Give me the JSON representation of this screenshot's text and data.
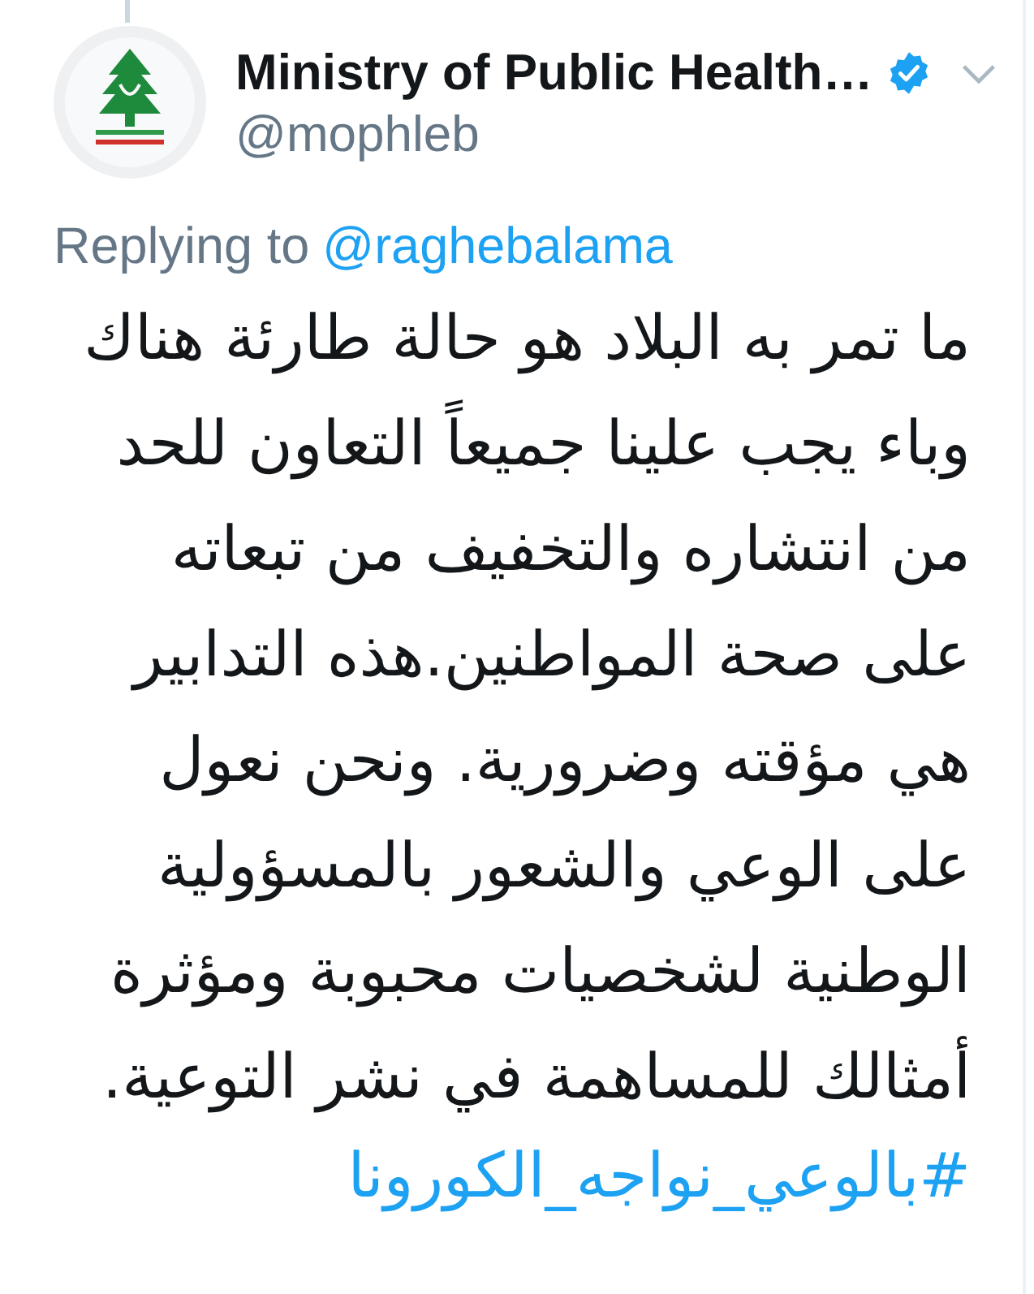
{
  "tweet": {
    "author": {
      "name": "Ministry of Public Health…",
      "handle": "@mophleb",
      "verified": true
    },
    "reply_to": {
      "label": "Replying to",
      "handle": "@raghebalama"
    },
    "text": "ما تمر به البلاد هو حالة طارئة هناك\nوباء يجب علينا جميعاً التعاون للحد\nمن انتشاره والتخفيف من تبعاته\nعلى صحة المواطنين.هذه التدابير\nهي مؤقته وضرورية. ونحن نعول\nعلى الوعي والشعور بالمسؤولية\nالوطنية لشخصيات محبوبة ومؤثرة\nأمثالك للمساهمة في نشر التوعية.",
    "hashtag": "#بالوعي_نواجه_الكورونا"
  }
}
